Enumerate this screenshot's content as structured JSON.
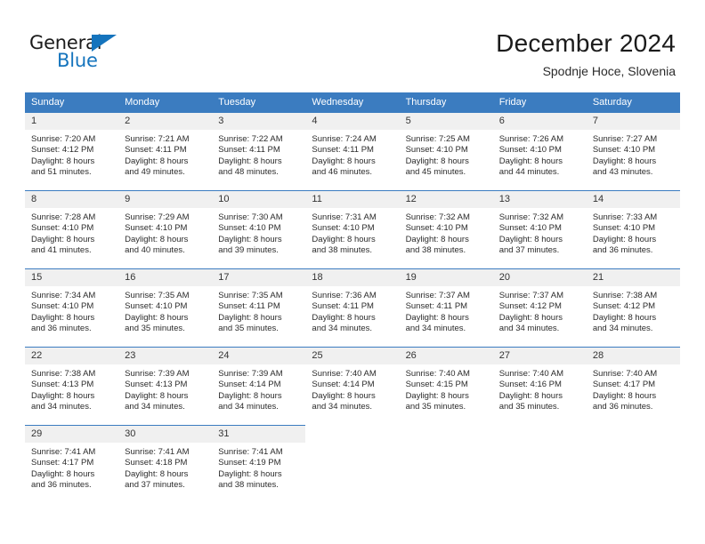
{
  "brand": {
    "name_part1": "General",
    "name_part2": "Blue",
    "accent_color": "#1574bd"
  },
  "header": {
    "title": "December 2024",
    "subtitle": "Spodnje Hoce, Slovenia"
  },
  "theme": {
    "header_row_bg": "#3b7cc0",
    "daynum_bg": "#f0f0f0",
    "text_color": "#2b2b2b"
  },
  "weekday_headers": [
    "Sunday",
    "Monday",
    "Tuesday",
    "Wednesday",
    "Thursday",
    "Friday",
    "Saturday"
  ],
  "weeks": [
    [
      {
        "day": "1",
        "sunrise": "Sunrise: 7:20 AM",
        "sunset": "Sunset: 4:12 PM",
        "daylight1": "Daylight: 8 hours",
        "daylight2": "and 51 minutes."
      },
      {
        "day": "2",
        "sunrise": "Sunrise: 7:21 AM",
        "sunset": "Sunset: 4:11 PM",
        "daylight1": "Daylight: 8 hours",
        "daylight2": "and 49 minutes."
      },
      {
        "day": "3",
        "sunrise": "Sunrise: 7:22 AM",
        "sunset": "Sunset: 4:11 PM",
        "daylight1": "Daylight: 8 hours",
        "daylight2": "and 48 minutes."
      },
      {
        "day": "4",
        "sunrise": "Sunrise: 7:24 AM",
        "sunset": "Sunset: 4:11 PM",
        "daylight1": "Daylight: 8 hours",
        "daylight2": "and 46 minutes."
      },
      {
        "day": "5",
        "sunrise": "Sunrise: 7:25 AM",
        "sunset": "Sunset: 4:10 PM",
        "daylight1": "Daylight: 8 hours",
        "daylight2": "and 45 minutes."
      },
      {
        "day": "6",
        "sunrise": "Sunrise: 7:26 AM",
        "sunset": "Sunset: 4:10 PM",
        "daylight1": "Daylight: 8 hours",
        "daylight2": "and 44 minutes."
      },
      {
        "day": "7",
        "sunrise": "Sunrise: 7:27 AM",
        "sunset": "Sunset: 4:10 PM",
        "daylight1": "Daylight: 8 hours",
        "daylight2": "and 43 minutes."
      }
    ],
    [
      {
        "day": "8",
        "sunrise": "Sunrise: 7:28 AM",
        "sunset": "Sunset: 4:10 PM",
        "daylight1": "Daylight: 8 hours",
        "daylight2": "and 41 minutes."
      },
      {
        "day": "9",
        "sunrise": "Sunrise: 7:29 AM",
        "sunset": "Sunset: 4:10 PM",
        "daylight1": "Daylight: 8 hours",
        "daylight2": "and 40 minutes."
      },
      {
        "day": "10",
        "sunrise": "Sunrise: 7:30 AM",
        "sunset": "Sunset: 4:10 PM",
        "daylight1": "Daylight: 8 hours",
        "daylight2": "and 39 minutes."
      },
      {
        "day": "11",
        "sunrise": "Sunrise: 7:31 AM",
        "sunset": "Sunset: 4:10 PM",
        "daylight1": "Daylight: 8 hours",
        "daylight2": "and 38 minutes."
      },
      {
        "day": "12",
        "sunrise": "Sunrise: 7:32 AM",
        "sunset": "Sunset: 4:10 PM",
        "daylight1": "Daylight: 8 hours",
        "daylight2": "and 38 minutes."
      },
      {
        "day": "13",
        "sunrise": "Sunrise: 7:32 AM",
        "sunset": "Sunset: 4:10 PM",
        "daylight1": "Daylight: 8 hours",
        "daylight2": "and 37 minutes."
      },
      {
        "day": "14",
        "sunrise": "Sunrise: 7:33 AM",
        "sunset": "Sunset: 4:10 PM",
        "daylight1": "Daylight: 8 hours",
        "daylight2": "and 36 minutes."
      }
    ],
    [
      {
        "day": "15",
        "sunrise": "Sunrise: 7:34 AM",
        "sunset": "Sunset: 4:10 PM",
        "daylight1": "Daylight: 8 hours",
        "daylight2": "and 36 minutes."
      },
      {
        "day": "16",
        "sunrise": "Sunrise: 7:35 AM",
        "sunset": "Sunset: 4:10 PM",
        "daylight1": "Daylight: 8 hours",
        "daylight2": "and 35 minutes."
      },
      {
        "day": "17",
        "sunrise": "Sunrise: 7:35 AM",
        "sunset": "Sunset: 4:11 PM",
        "daylight1": "Daylight: 8 hours",
        "daylight2": "and 35 minutes."
      },
      {
        "day": "18",
        "sunrise": "Sunrise: 7:36 AM",
        "sunset": "Sunset: 4:11 PM",
        "daylight1": "Daylight: 8 hours",
        "daylight2": "and 34 minutes."
      },
      {
        "day": "19",
        "sunrise": "Sunrise: 7:37 AM",
        "sunset": "Sunset: 4:11 PM",
        "daylight1": "Daylight: 8 hours",
        "daylight2": "and 34 minutes."
      },
      {
        "day": "20",
        "sunrise": "Sunrise: 7:37 AM",
        "sunset": "Sunset: 4:12 PM",
        "daylight1": "Daylight: 8 hours",
        "daylight2": "and 34 minutes."
      },
      {
        "day": "21",
        "sunrise": "Sunrise: 7:38 AM",
        "sunset": "Sunset: 4:12 PM",
        "daylight1": "Daylight: 8 hours",
        "daylight2": "and 34 minutes."
      }
    ],
    [
      {
        "day": "22",
        "sunrise": "Sunrise: 7:38 AM",
        "sunset": "Sunset: 4:13 PM",
        "daylight1": "Daylight: 8 hours",
        "daylight2": "and 34 minutes."
      },
      {
        "day": "23",
        "sunrise": "Sunrise: 7:39 AM",
        "sunset": "Sunset: 4:13 PM",
        "daylight1": "Daylight: 8 hours",
        "daylight2": "and 34 minutes."
      },
      {
        "day": "24",
        "sunrise": "Sunrise: 7:39 AM",
        "sunset": "Sunset: 4:14 PM",
        "daylight1": "Daylight: 8 hours",
        "daylight2": "and 34 minutes."
      },
      {
        "day": "25",
        "sunrise": "Sunrise: 7:40 AM",
        "sunset": "Sunset: 4:14 PM",
        "daylight1": "Daylight: 8 hours",
        "daylight2": "and 34 minutes."
      },
      {
        "day": "26",
        "sunrise": "Sunrise: 7:40 AM",
        "sunset": "Sunset: 4:15 PM",
        "daylight1": "Daylight: 8 hours",
        "daylight2": "and 35 minutes."
      },
      {
        "day": "27",
        "sunrise": "Sunrise: 7:40 AM",
        "sunset": "Sunset: 4:16 PM",
        "daylight1": "Daylight: 8 hours",
        "daylight2": "and 35 minutes."
      },
      {
        "day": "28",
        "sunrise": "Sunrise: 7:40 AM",
        "sunset": "Sunset: 4:17 PM",
        "daylight1": "Daylight: 8 hours",
        "daylight2": "and 36 minutes."
      }
    ],
    [
      {
        "day": "29",
        "sunrise": "Sunrise: 7:41 AM",
        "sunset": "Sunset: 4:17 PM",
        "daylight1": "Daylight: 8 hours",
        "daylight2": "and 36 minutes."
      },
      {
        "day": "30",
        "sunrise": "Sunrise: 7:41 AM",
        "sunset": "Sunset: 4:18 PM",
        "daylight1": "Daylight: 8 hours",
        "daylight2": "and 37 minutes."
      },
      {
        "day": "31",
        "sunrise": "Sunrise: 7:41 AM",
        "sunset": "Sunset: 4:19 PM",
        "daylight1": "Daylight: 8 hours",
        "daylight2": "and 38 minutes."
      },
      null,
      null,
      null,
      null
    ]
  ]
}
